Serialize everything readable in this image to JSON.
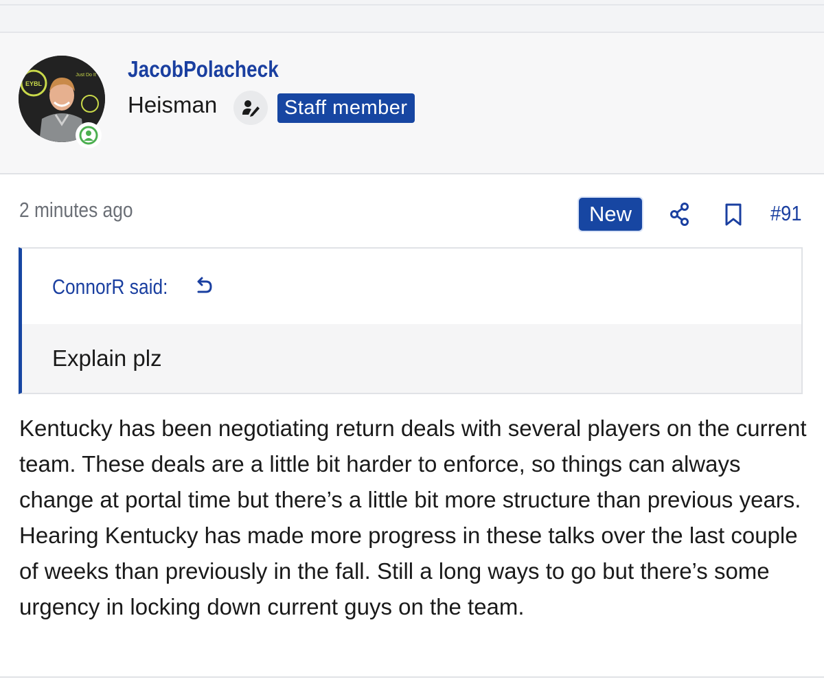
{
  "user": {
    "username": "JacobPolacheck",
    "title": "Heisman",
    "staff_badge": "Staff member",
    "avatar_text_left": "EYBL",
    "avatar_text_right": "Just Do It"
  },
  "post": {
    "timestamp": "2 minutes ago",
    "new_badge": "New",
    "number": "#91",
    "quote": {
      "author": "ConnorR said:",
      "text": "Explain plz"
    },
    "message": "Kentucky has been negotiating return deals with several players on the current team. These deals are a little bit harder to enforce, so things can always change at portal time but there’s a little bit more structure than previous years. Hearing Kentucky has made more progress in these talks over the last couple of weeks than previously in the fall. Still a long ways to go but there’s some urgency in locking down current guys on the team."
  },
  "colors": {
    "accent": "#1746a2",
    "link": "#1a3fa0",
    "online": "#4caf50"
  }
}
